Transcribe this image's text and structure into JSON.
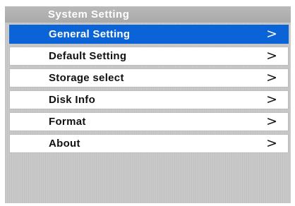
{
  "title": "System Setting",
  "menu": {
    "items": [
      {
        "label": "General Setting",
        "arrow": ">"
      },
      {
        "label": "Default Setting",
        "arrow": ">"
      },
      {
        "label": "Storage select",
        "arrow": ">"
      },
      {
        "label": "Disk Info",
        "arrow": ">"
      },
      {
        "label": "Format",
        "arrow": ">"
      },
      {
        "label": "About",
        "arrow": ">"
      }
    ],
    "selected_index": 0
  },
  "colors": {
    "selected": "#0a64d8",
    "title_bar": "#afafaf",
    "background": "#c9c9c9"
  },
  "icons": {
    "arrow": "chevron-right-icon"
  }
}
